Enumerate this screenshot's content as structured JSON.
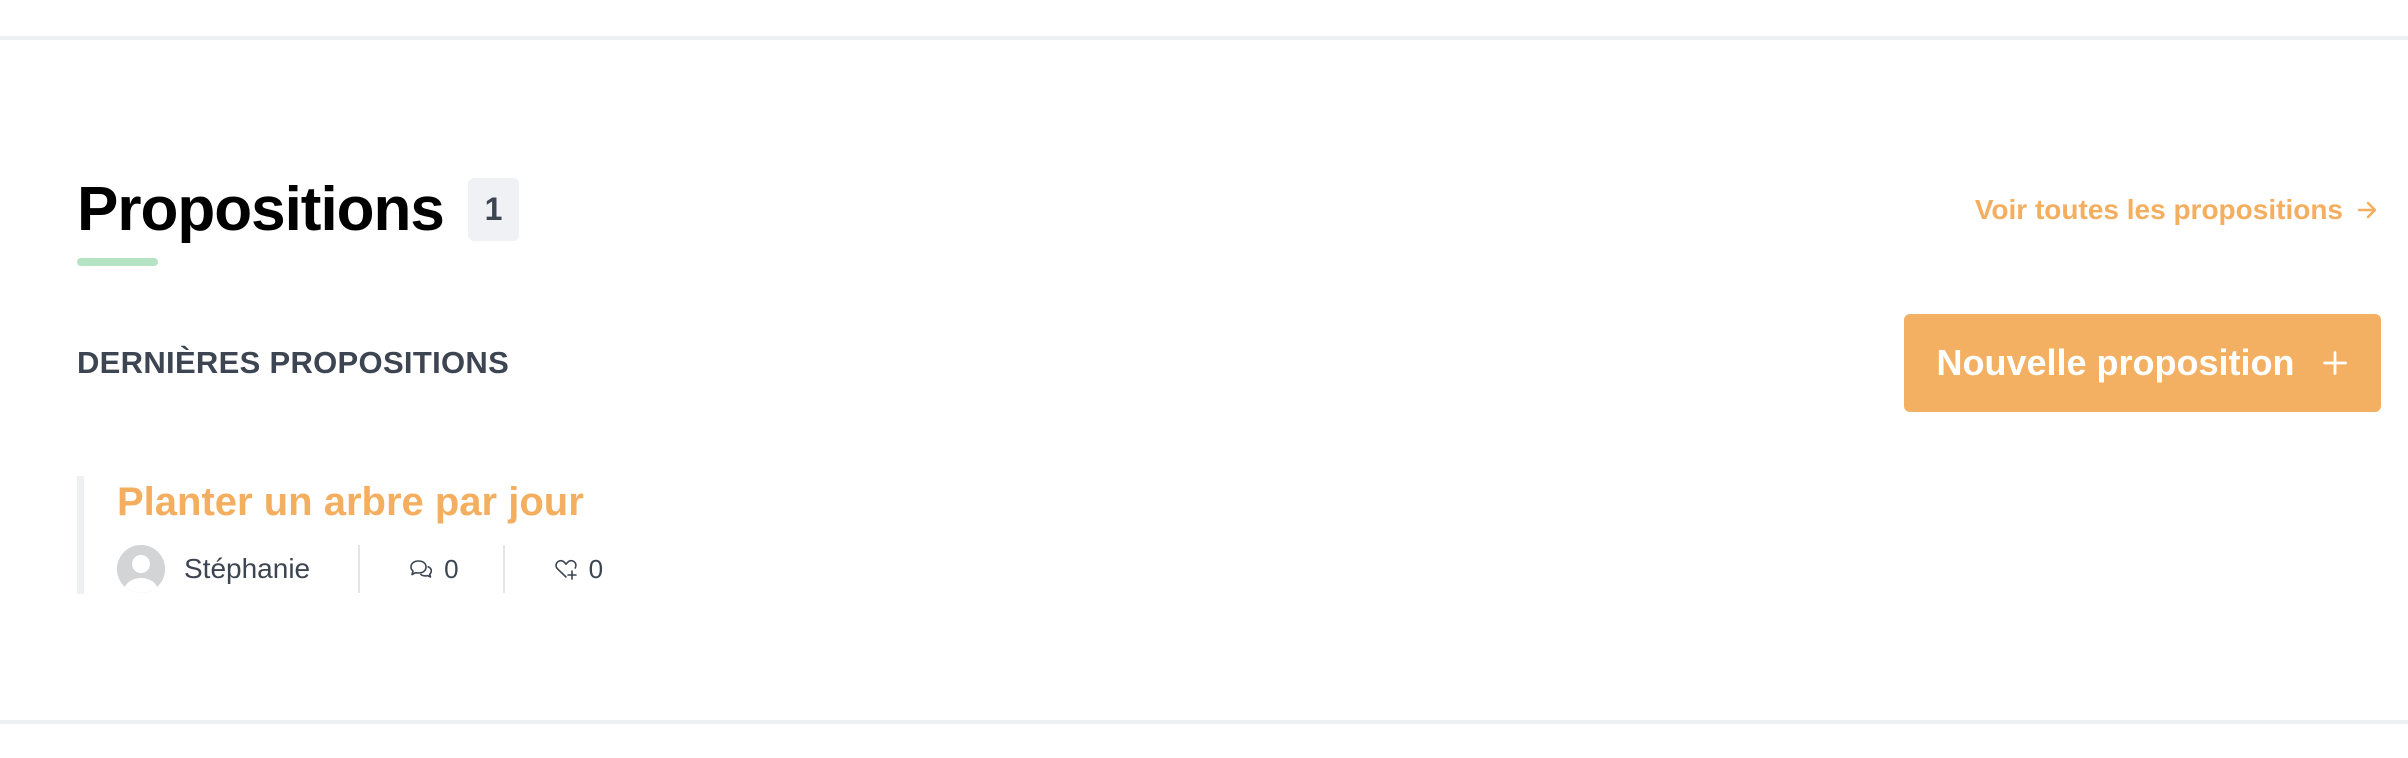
{
  "header": {
    "title": "Propositions",
    "count": "1",
    "view_all_label": "Voir toutes les propositions"
  },
  "toolbar": {
    "subheading": "DERNIÈRES PROPOSITIONS",
    "new_button_label": "Nouvelle proposition"
  },
  "proposals": [
    {
      "title": "Planter un arbre par jour",
      "author": "Stéphanie",
      "comments": "0",
      "endorsements": "0"
    }
  ],
  "colors": {
    "accent": "#f4ae5f",
    "button": "#f4b062",
    "underline": "#b5e4c4",
    "text_dark": "#3d4552"
  },
  "icons": {
    "view_all": "arrow-right-icon",
    "new_button": "plus-icon",
    "avatar": "default-avatar-icon",
    "comments": "comments-icon",
    "endorsements": "heart-plus-icon"
  }
}
